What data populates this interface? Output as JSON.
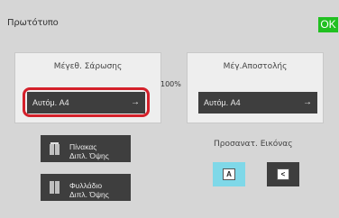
{
  "header": {
    "title": "Πρωτότυπο",
    "ok_label": "OK"
  },
  "scan_panel": {
    "label": "Μέγεθ. Σάρωσης",
    "value": "Αυτόμ. A4"
  },
  "send_panel": {
    "label": "Μέγ.Αποστολής",
    "value": "Αυτόμ. A4"
  },
  "ratio": "100%",
  "duplex_book": {
    "line1": "Πίνακας",
    "line2": "Διπλ. Όψης"
  },
  "duplex_tablet": {
    "line1": "Φυλλάδιο",
    "line2": "Διπλ. Όψης"
  },
  "orientation": {
    "label": "Προσανατ. Εικόνας",
    "portrait_glyph": "A",
    "landscape_glyph": "<"
  },
  "colors": {
    "ok": "#21c021",
    "highlight": "#d4202a",
    "selected": "#7fd8e8",
    "button": "#3e3e3e"
  }
}
